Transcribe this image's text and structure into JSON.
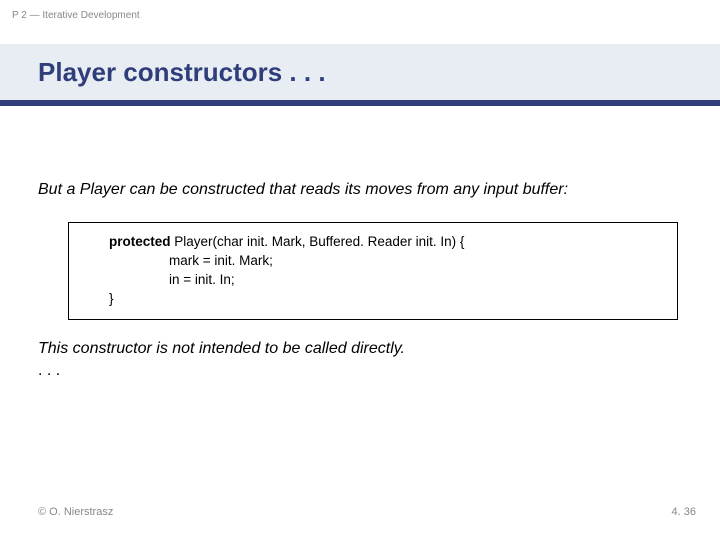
{
  "header": {
    "section_label": "P 2 — Iterative Development",
    "title": "Player constructors . . ."
  },
  "body": {
    "intro": "But a Player can be constructed that reads its moves from any input buffer:",
    "code": {
      "access_modifier": "protected",
      "rest_line1": " Player(char init. Mark, Buffered. Reader init. In) {",
      "line2": "mark = init. Mark;",
      "line3": "in = init. In;",
      "line4": "}"
    },
    "outro": "This constructor is not intended to be called directly.",
    "ellipsis": ". . ."
  },
  "footer": {
    "copyright": "© O. Nierstrasz",
    "page": "4. 36"
  }
}
